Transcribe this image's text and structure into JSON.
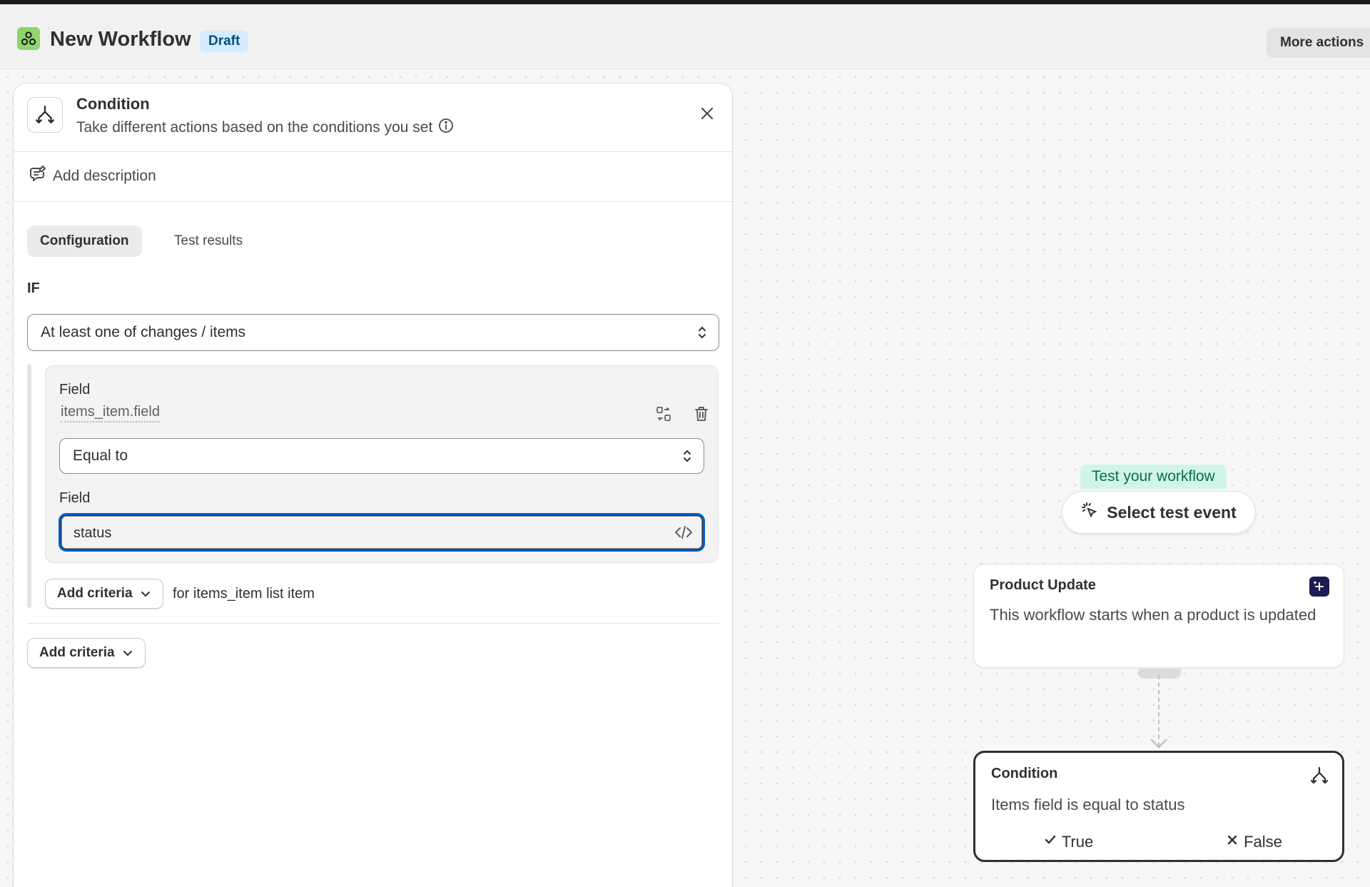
{
  "header": {
    "title": "New Workflow",
    "status_badge": "Draft",
    "more_actions": "More actions"
  },
  "panel": {
    "title": "Condition",
    "subtitle": "Take different actions based on the conditions you set",
    "add_description": "Add description",
    "tabs": [
      {
        "label": "Configuration",
        "active": true
      },
      {
        "label": "Test results",
        "active": false
      }
    ],
    "if_label": "IF",
    "scope_select": "At least one of changes / items",
    "criteria": {
      "field_label": "Field",
      "field_value": "items_item.field",
      "operator": "Equal to",
      "value_label": "Field",
      "value": "status"
    },
    "add_criteria_inner": "Add criteria",
    "for_text": "for items_item list item",
    "add_criteria_outer": "Add criteria"
  },
  "canvas": {
    "test_label": "Test your workflow",
    "select_event": "Select test event",
    "trigger_node": {
      "title": "Product Update",
      "body": "This workflow starts when a product is updated"
    },
    "condition_node": {
      "title": "Condition",
      "body": "Items field is equal to status",
      "true_label": "True",
      "false_label": "False"
    }
  },
  "colors": {
    "accent_focus": "#005bd3",
    "draft_badge_bg": "#d5ebff",
    "test_pill_bg": "#d0f5e8",
    "trigger_badge": "#1c1c54"
  }
}
